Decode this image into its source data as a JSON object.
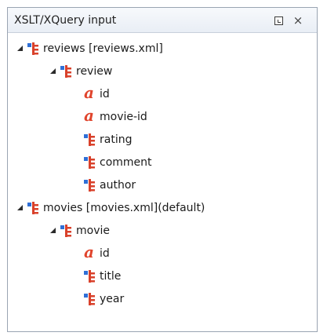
{
  "panel": {
    "title": "XSLT/XQuery input",
    "restore_icon": "restore-icon",
    "close_icon": "close-icon",
    "close_glyph": "×"
  },
  "colors": {
    "element_icon_blue": "#2f6fd6",
    "element_icon_red": "#d9412b",
    "attribute_icon": "#e0442c",
    "expander": "#2b2b2b"
  },
  "tree": [
    {
      "label": "reviews [reviews.xml]",
      "kind": "element",
      "expanded": true,
      "icon": "element-icon"
    },
    {
      "label": "review",
      "kind": "element",
      "expanded": true,
      "icon": "element-icon"
    },
    {
      "label": "id",
      "kind": "attribute",
      "icon": "attribute-icon",
      "glyph": "a"
    },
    {
      "label": "movie-id",
      "kind": "attribute",
      "icon": "attribute-icon",
      "glyph": "a"
    },
    {
      "label": "rating",
      "kind": "element",
      "icon": "element-icon"
    },
    {
      "label": "comment",
      "kind": "element",
      "icon": "element-icon"
    },
    {
      "label": "author",
      "kind": "element",
      "icon": "element-icon"
    },
    {
      "label": "movies [movies.xml](default)",
      "kind": "element",
      "expanded": true,
      "icon": "element-icon"
    },
    {
      "label": "movie",
      "kind": "element",
      "expanded": true,
      "icon": "element-icon"
    },
    {
      "label": "id",
      "kind": "attribute",
      "icon": "attribute-icon",
      "glyph": "a"
    },
    {
      "label": "title",
      "kind": "element",
      "icon": "element-icon"
    },
    {
      "label": "year",
      "kind": "element",
      "icon": "element-icon"
    }
  ]
}
